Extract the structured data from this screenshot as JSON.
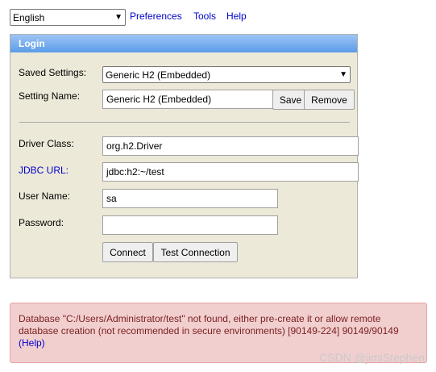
{
  "toolbar": {
    "language": "English",
    "preferences": "Preferences",
    "tools": "Tools",
    "help": "Help"
  },
  "login": {
    "title": "Login",
    "saved_settings_label": "Saved Settings:",
    "saved_settings_value": "Generic H2 (Embedded)",
    "setting_name_label": "Setting Name:",
    "setting_name_value": "Generic H2 (Embedded)",
    "save_button": "Save",
    "remove_button": "Remove",
    "driver_class_label": "Driver Class:",
    "driver_class_value": "org.h2.Driver",
    "jdbc_url_label": "JDBC URL:",
    "jdbc_url_value": "jdbc:h2:~/test",
    "user_name_label": "User Name:",
    "user_name_value": "sa",
    "password_label": "Password:",
    "password_value": "",
    "connect_button": "Connect",
    "test_connection_button": "Test Connection"
  },
  "error": {
    "message": "Database \"C:/Users/Administrator/test\" not found, either pre-create it or allow remote database creation (not recommended in secure environments) [90149-224] 90149/90149",
    "help_link": "(Help)"
  },
  "watermark": "CSDN @jimiStephen",
  "colors": {
    "panel_bg": "#ece9d8",
    "header_blue": "#5a9be8",
    "link_blue": "#0000cc",
    "error_bg": "#f2cfcf"
  }
}
